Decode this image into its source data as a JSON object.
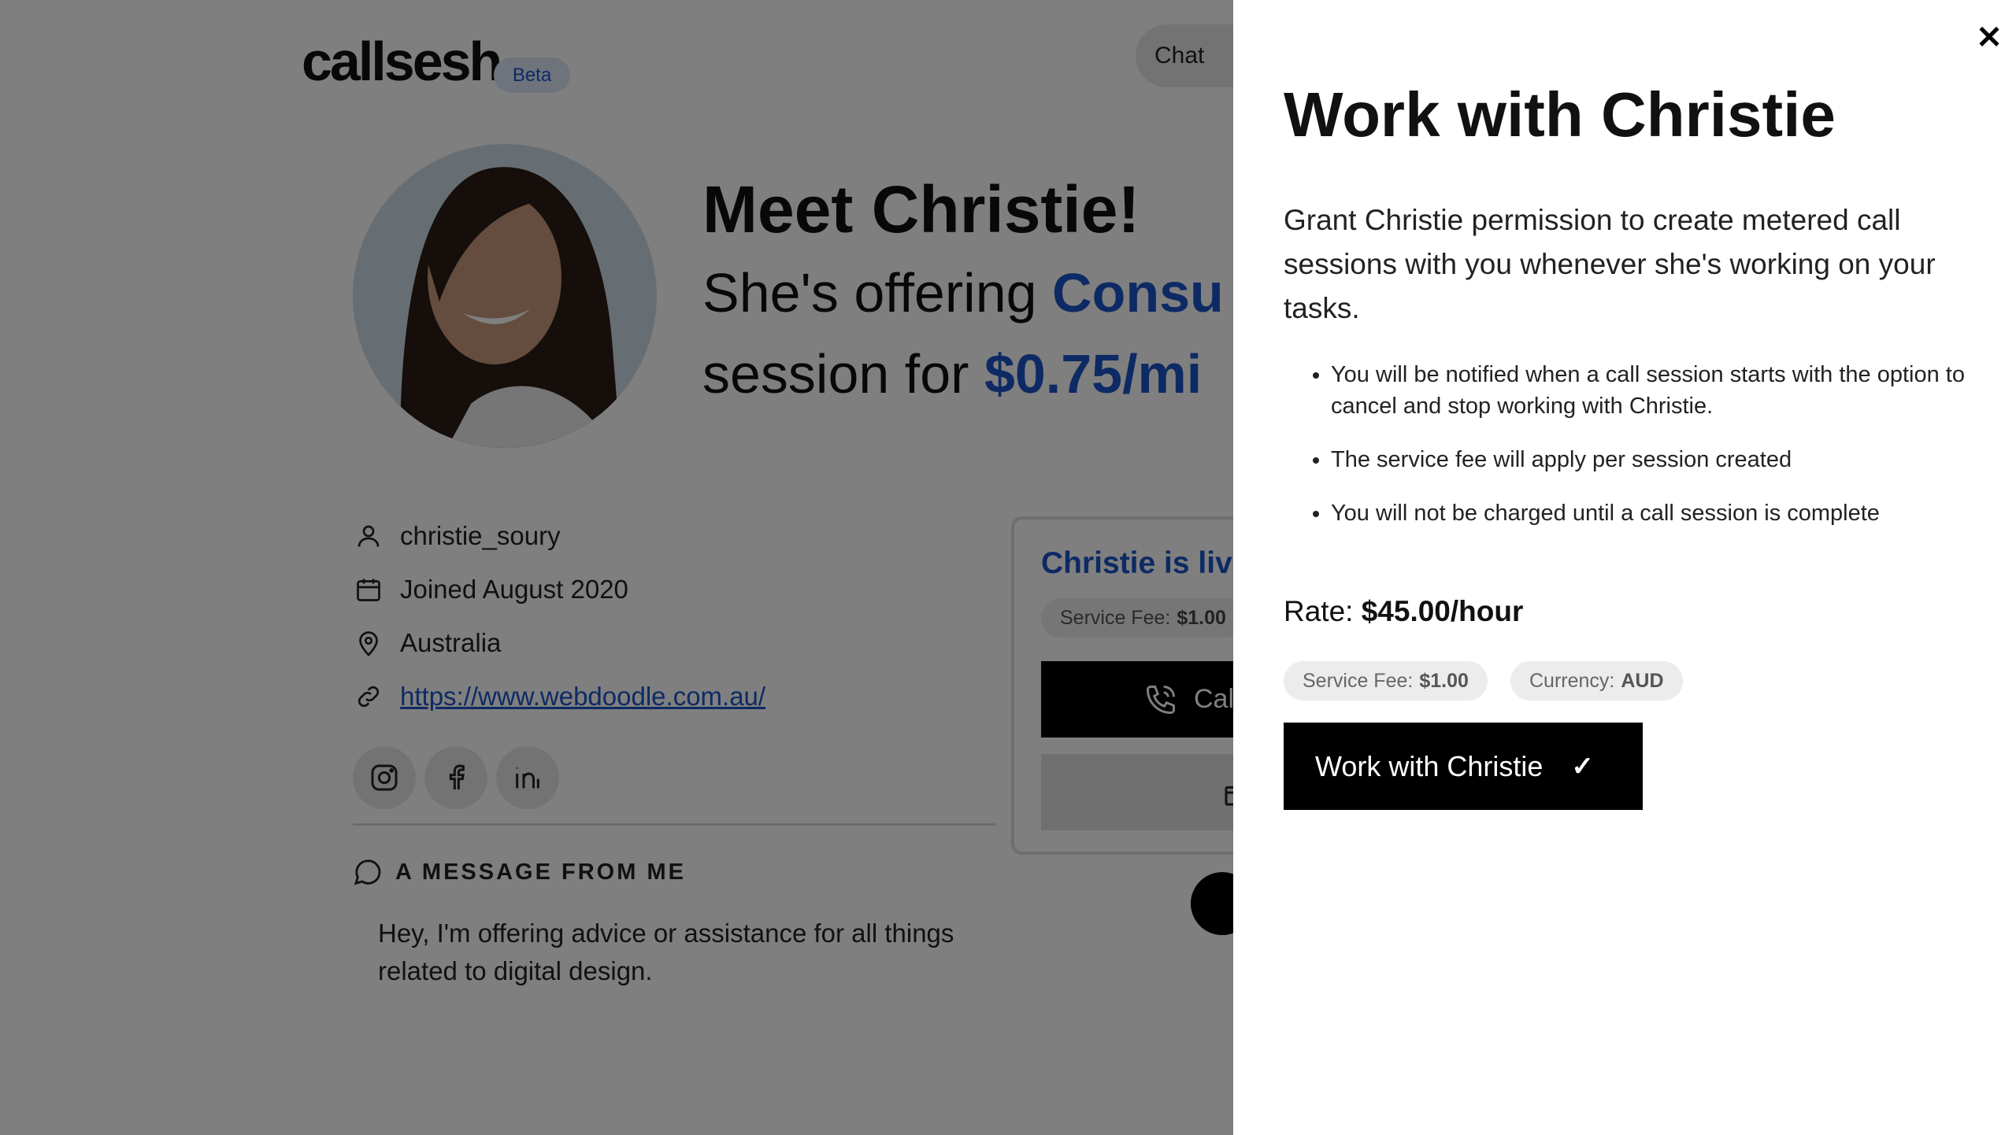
{
  "header": {
    "logo_text": "callsesh",
    "beta_label": "Beta",
    "chat_label": "Chat"
  },
  "profile": {
    "headline": "Meet Christie!",
    "offer_prefix": "She's offering ",
    "offer_service": "Consu",
    "offer_line2_prefix": "session for ",
    "offer_price": "$0.75/mi",
    "username": "christie_soury",
    "joined": "Joined August 2020",
    "location": "Australia",
    "website": "https://www.webdoodle.com.au/"
  },
  "social": {
    "icons": [
      "instagram-icon",
      "facebook-icon",
      "linkedin-icon"
    ]
  },
  "message": {
    "heading": "A MESSAGE FROM ME",
    "body": "Hey, I'm offering advice or assistance for all things related to digital design."
  },
  "live_card": {
    "title": "Christie is live",
    "service_fee_label": "Service Fee:",
    "service_fee_value": "$1.00",
    "call_label": "Cal"
  },
  "drawer": {
    "close_symbol": "✕",
    "title": "Work with Christie",
    "description": "Grant Christie permission to create metered call sessions with you whenever she's working on your tasks.",
    "bullets": [
      "You will be notified when a call session starts with the option to cancel and stop working with Christie.",
      "The service fee will apply per session created",
      "You will not be charged until a call session is complete"
    ],
    "rate_label": "Rate:",
    "rate_value": "$45.00/hour",
    "service_fee_label": "Service Fee:",
    "service_fee_value": "$1.00",
    "currency_label": "Currency:",
    "currency_value": "AUD",
    "button_label": "Work with Christie",
    "button_check": "✓"
  },
  "colors": {
    "accent_blue": "#1a55c9",
    "overlay": "rgba(0,0,0,0.5)",
    "button_black": "#000000"
  }
}
